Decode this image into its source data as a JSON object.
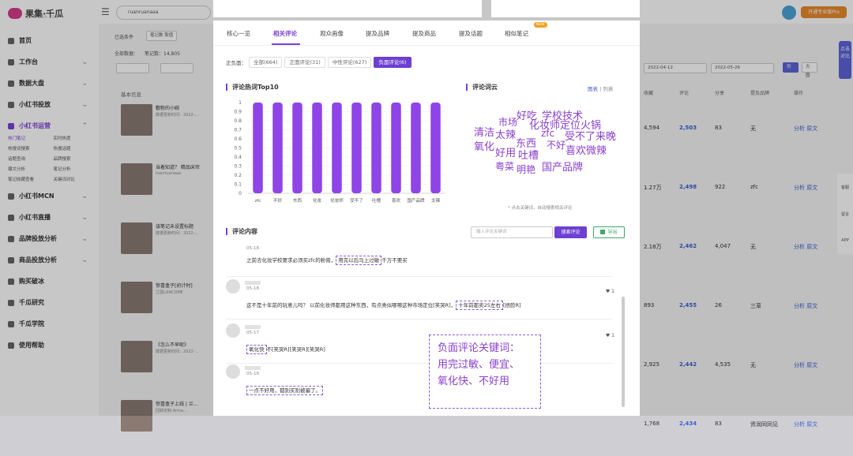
{
  "app": {
    "logo": "果集·千瓜",
    "logo_sub": "QIAN-GUA.COM",
    "search_value": "ruanruanaaa",
    "pro_label": "开通专业版Pro"
  },
  "sidebar": {
    "items": [
      {
        "label": "首页",
        "chev": ""
      },
      {
        "label": "工作台",
        "chev": "⌄"
      },
      {
        "label": "数据大盘",
        "chev": "⌄"
      },
      {
        "label": "小红书投放",
        "chev": "⌄"
      },
      {
        "label": "小红书运营",
        "chev": "⌃",
        "active": true
      },
      {
        "label": "小红书MCN",
        "chev": "⌄"
      },
      {
        "label": "小红书直播",
        "chev": "⌄"
      },
      {
        "label": "品牌投放分析",
        "chev": "⌄"
      },
      {
        "label": "商品投放分析",
        "chev": "⌄"
      },
      {
        "label": "购买破冰",
        "chev": ""
      },
      {
        "label": "千瓜研究",
        "chev": ""
      },
      {
        "label": "千瓜学院",
        "chev": ""
      },
      {
        "label": "使用帮助",
        "chev": ""
      }
    ],
    "sub": [
      "热门笔记",
      "实时热度",
      "热搜词搜索",
      "热搜话题",
      "话题查询",
      "品牌搜索",
      "爆文分析",
      "笔记分析",
      "笔记收藏查看",
      "关键词对比"
    ]
  },
  "filters": {
    "selected_label": "已选条件",
    "chip1": "笔记数 取值",
    "all_data": "全部数据：",
    "notes": "笔记数：14,805",
    "dates": [
      "2022-04-12",
      "2022-05-26"
    ],
    "list": "列表",
    "big": "大图"
  },
  "table": {
    "headers": [
      "收藏",
      "评论",
      "分享",
      "提及品牌",
      "操作"
    ],
    "rows": [
      {
        "fav": "4,594",
        "cmt": "2,503",
        "share": "83",
        "brand": "无",
        "act": [
          "分析",
          "原文"
        ]
      },
      {
        "fav": "1.27万",
        "cmt": "2,498",
        "share": "922",
        "brand": "zfc",
        "act": [
          "分析",
          "原文"
        ]
      },
      {
        "fav": "2.18万",
        "cmt": "2,462",
        "share": "4,047",
        "brand": "无",
        "act": [
          "分析",
          "原文"
        ]
      },
      {
        "fav": "893",
        "cmt": "2,455",
        "share": "26",
        "brand": "三草",
        "act": [
          "分析",
          "原文"
        ]
      },
      {
        "fav": "2,925",
        "cmt": "2,442",
        "share": "4,535",
        "brand": "无",
        "act": [
          "分析",
          "原文"
        ]
      },
      {
        "fav": "1,768",
        "cmt": "2,434",
        "share": "83",
        "brand": "资润同同见",
        "act": [
          "分析",
          "原文"
        ]
      }
    ],
    "left_header": "基本信息",
    "left_rows": [
      {
        "title": "敷粉的小碗",
        "sub": "数据更新时间：2022-…"
      },
      {
        "title": "当着知道？ 精品床帘",
        "sub": "ruanruanaaa"
      },
      {
        "title": "该笔记未设置标题",
        "sub": "数据更新时间：2022-…"
      },
      {
        "title": "惊喜盒子[初计时]",
        "sub": "兰蔻LANCOME"
      },
      {
        "title": "《怎么不早呢》",
        "sub": "数据更新时间：2022-…"
      },
      {
        "title": "惊喜盒子上线 | 兰…",
        "sub": "回转定制 Arma…"
      }
    ]
  },
  "dock": {
    "btn": "点击对比",
    "items": [
      "客服",
      "留言",
      "APP"
    ]
  },
  "modal": {
    "tabs": [
      "核心一览",
      "相关评论",
      "观众画像",
      "提及品牌",
      "提及商品",
      "提及话题",
      "相似笔记"
    ],
    "new_badge": "NEW",
    "polarity_label": "正负面：",
    "polarity": [
      "全部(664)",
      "正面评论(31)",
      "中性评论(627)",
      "负面评论(6)"
    ],
    "hot_title": "评论热词Top10",
    "cloud_title": "评论词云",
    "cloud_toggle": {
      "on": "图表",
      "sep": " | ",
      "off": "列表"
    },
    "cloud_hint": "* 点击关键词，自动搜索相关评论",
    "content_title": "评论内容",
    "search_placeholder": "输入评论关键词",
    "search_btn": "搜索评论",
    "export_btn": "导出",
    "cloud_words": [
      "好吃",
      "学校技术",
      "市场",
      "化妆师定位火锅",
      "清洁",
      "太辣",
      "zfc",
      "受不了来晚",
      "氧化",
      "东西",
      "不好",
      "喜欢微辣",
      "好用",
      "吐槽",
      "粤菜",
      "明艳",
      "国产品牌"
    ],
    "comments": [
      {
        "date": "05-18",
        "pre": "之前去化妆学校要求必须买zfc的粉膏，",
        "hl": "用完以后马上过敏",
        "post": "千万不要买",
        "likes": ""
      },
      {
        "date": "05-18",
        "pre": "这不是十年前的玩意儿吗？ 以前化妆师都用这种东西，有点类似哪哪这种市场定位[笑哭R]，",
        "hl": "十年前都卖25左右",
        "post": "[捂脸R]",
        "likes": "1"
      },
      {
        "date": "05-17",
        "pre": "",
        "hl": "氧化快",
        "post": "不[笑哭R][笑哭R][笑哭R]",
        "likes": "1"
      },
      {
        "date": "05-18",
        "pre": "",
        "hl": "一点不好用，都别买别被骗了。",
        "post": "",
        "likes": ""
      }
    ],
    "callout": [
      "负面评论关键词：",
      "用完过敏、便宜、",
      "氧化快、不好用"
    ]
  },
  "chart_data": {
    "type": "bar",
    "categories": [
      "zfc",
      "不好",
      "东西",
      "化妆",
      "化妆师",
      "受不了",
      "吐槽",
      "喜欢",
      "国产品牌",
      "太辣"
    ],
    "values": [
      1,
      1,
      1,
      1,
      1,
      1,
      1,
      1,
      1,
      1
    ],
    "ylim": [
      0,
      1
    ],
    "yticks": [
      0,
      0.1,
      0.2,
      0.3,
      0.4,
      0.5,
      0.6,
      0.7,
      0.8,
      0.9,
      1
    ],
    "color": "#8e44e6"
  }
}
